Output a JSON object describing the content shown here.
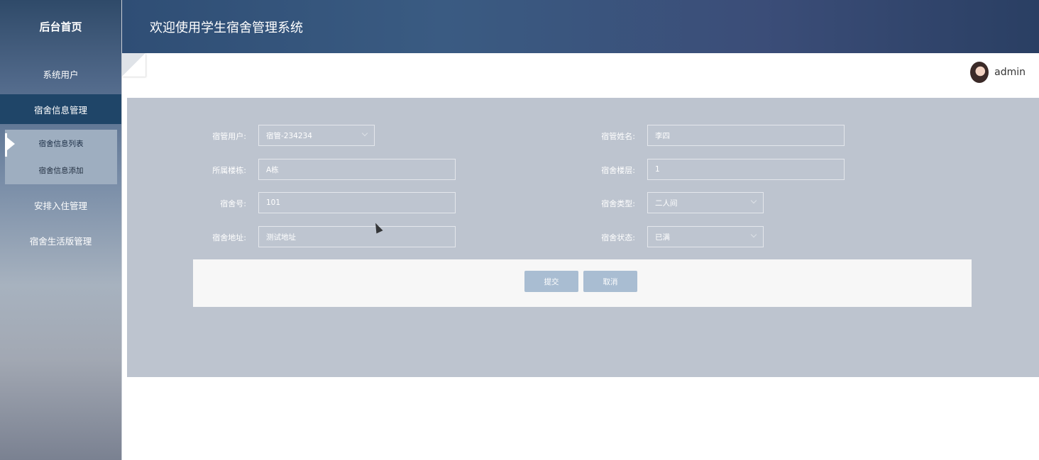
{
  "sidebar": {
    "brand": "后台首页",
    "items": [
      {
        "label": "系统用户"
      },
      {
        "label": "宿舍信息管理"
      },
      {
        "label": "安排入住管理"
      },
      {
        "label": "宿舍生活版管理"
      }
    ],
    "submenu": [
      {
        "label": "宿舍信息列表"
      },
      {
        "label": "宿舍信息添加"
      }
    ]
  },
  "header": {
    "title": "欢迎使用学生宿舍管理系统"
  },
  "topbar": {
    "username": "admin"
  },
  "form": {
    "fields": {
      "manager_user": {
        "label": "宿管用户:",
        "value": "宿管-234234"
      },
      "manager_name": {
        "label": "宿管姓名:",
        "value": "李四"
      },
      "building": {
        "label": "所属楼栋:",
        "value": "A栋"
      },
      "floor": {
        "label": "宿舍楼层:",
        "value": "1"
      },
      "room_no": {
        "label": "宿舍号:",
        "value": "101"
      },
      "room_type": {
        "label": "宿舍类型:",
        "value": "二人间"
      },
      "address": {
        "label": "宿舍地址:",
        "value": "测试地址"
      },
      "status": {
        "label": "宿舍状态:",
        "value": "已满"
      }
    },
    "submit_label": "提交",
    "cancel_label": "取消"
  },
  "colors": {
    "sidebar_active": "#1f4568",
    "panel_bg": "#bdc4cf",
    "button_bg": "#a9bdd2"
  }
}
